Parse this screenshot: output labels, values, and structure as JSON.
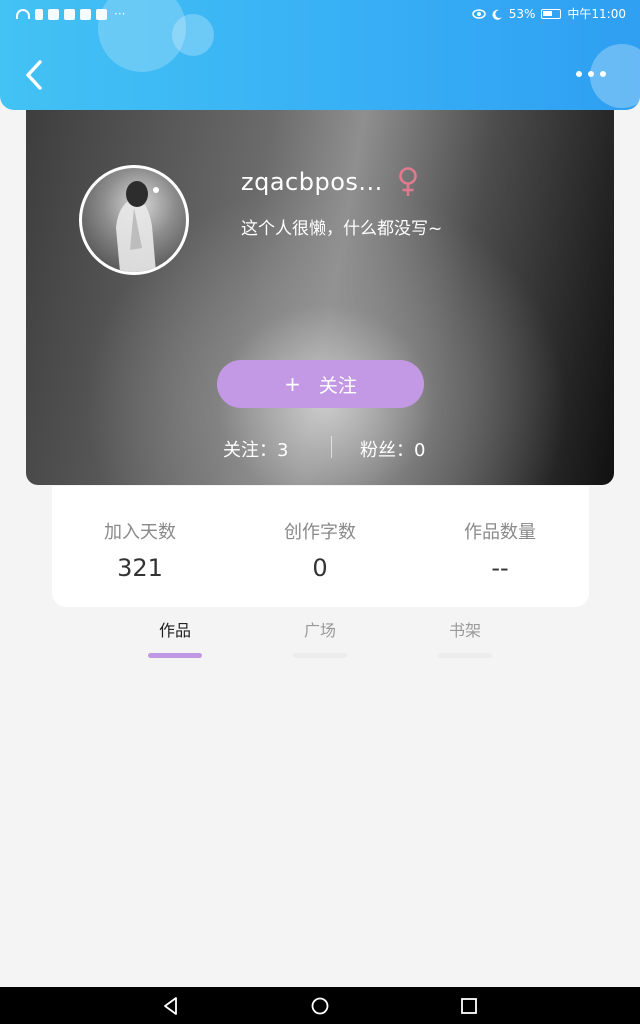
{
  "status_bar": {
    "battery": "53%",
    "time": "中午11:00",
    "overflow": "···"
  },
  "header": {
    "back_icon": "chevron-left-icon",
    "more_icon": "more-horizontal-icon",
    "colors": {
      "gradient_start": "#43c2f4",
      "gradient_end": "#2f9ff2"
    }
  },
  "profile": {
    "username": "zqacbpos...",
    "gender_icon": "female-symbol-icon",
    "gender_color": "#e07a8f",
    "bio": "这个人很懒，什么都没写~",
    "follow_button": {
      "plus": "+",
      "label": "关注",
      "color": "#c399e6"
    },
    "following": "关注：3",
    "fans": "粉丝：0"
  },
  "info": {
    "join_days": {
      "label": "加入天数",
      "value": "321"
    },
    "word_count": {
      "label": "创作字数",
      "value": "0"
    },
    "works_count": {
      "label": "作品数量",
      "value": "--"
    }
  },
  "tabs": [
    {
      "label": "作品",
      "active": true
    },
    {
      "label": "广场",
      "active": false
    },
    {
      "label": "书架",
      "active": false
    }
  ],
  "accent_color": "#c099e4"
}
